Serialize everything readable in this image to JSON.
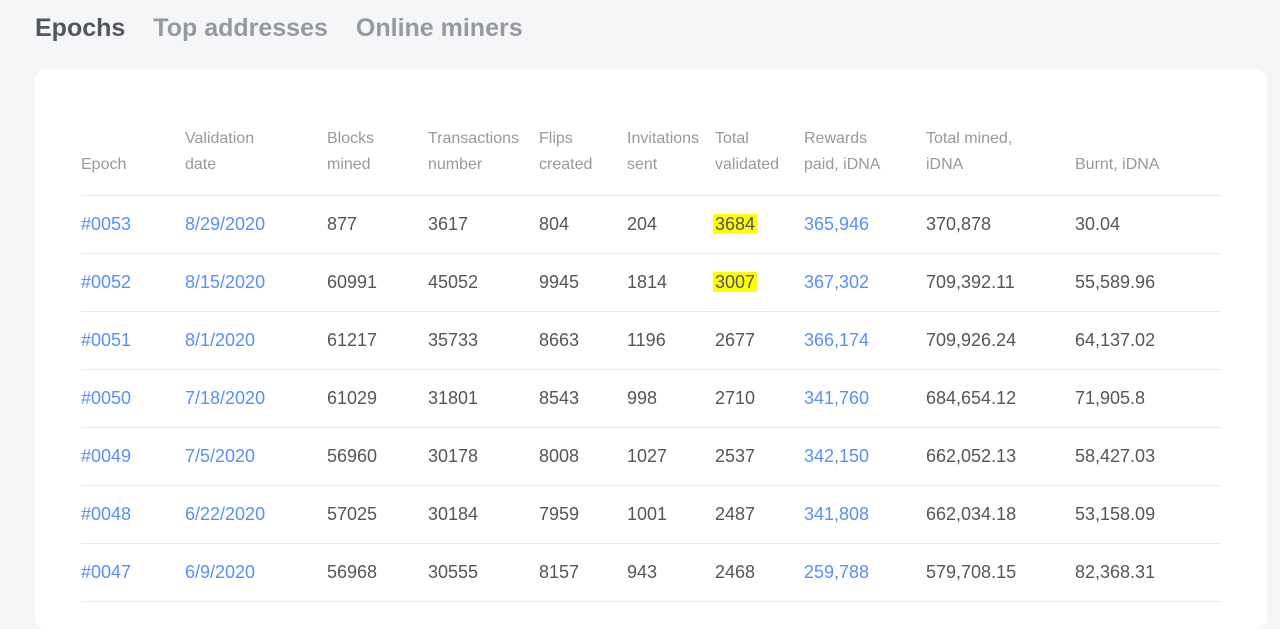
{
  "tabs": [
    {
      "label": "Epochs",
      "active": true
    },
    {
      "label": "Top addresses",
      "active": false
    },
    {
      "label": "Online miners",
      "active": false
    }
  ],
  "table": {
    "headers": {
      "epoch": "Epoch",
      "validation_date_1": "Validation",
      "validation_date_2": "date",
      "blocks_1": "Blocks",
      "blocks_2": "mined",
      "tx_1": "Transactions",
      "tx_2": "number",
      "flips_1": "Flips",
      "flips_2": "created",
      "inv_1": "Invitations",
      "inv_2": "sent",
      "validated_1": "Total",
      "validated_2": "validated",
      "rewards_1": "Rewards",
      "rewards_2": "paid, iDNA",
      "mined_1": "Total mined,",
      "mined_2": "iDNA",
      "burnt": "Burnt, iDNA"
    },
    "rows": [
      {
        "epoch": "#0053",
        "date": "8/29/2020",
        "blocks": "877",
        "tx": "3617",
        "flips": "804",
        "invites": "204",
        "validated": "3684",
        "rewards": "365,946",
        "mined": "370,878",
        "burnt": "30.04"
      },
      {
        "epoch": "#0052",
        "date": "8/15/2020",
        "blocks": "60991",
        "tx": "45052",
        "flips": "9945",
        "invites": "1814",
        "validated": "3007",
        "rewards": "367,302",
        "mined": "709,392.11",
        "burnt": "55,589.96"
      },
      {
        "epoch": "#0051",
        "date": "8/1/2020",
        "blocks": "61217",
        "tx": "35733",
        "flips": "8663",
        "invites": "1196",
        "validated": "2677",
        "rewards": "366,174",
        "mined": "709,926.24",
        "burnt": "64,137.02"
      },
      {
        "epoch": "#0050",
        "date": "7/18/2020",
        "blocks": "61029",
        "tx": "31801",
        "flips": "8543",
        "invites": "998",
        "validated": "2710",
        "rewards": "341,760",
        "mined": "684,654.12",
        "burnt": "71,905.8"
      },
      {
        "epoch": "#0049",
        "date": "7/5/2020",
        "blocks": "56960",
        "tx": "30178",
        "flips": "8008",
        "invites": "1027",
        "validated": "2537",
        "rewards": "342,150",
        "mined": "662,052.13",
        "burnt": "58,427.03"
      },
      {
        "epoch": "#0048",
        "date": "6/22/2020",
        "blocks": "57025",
        "tx": "30184",
        "flips": "7959",
        "invites": "1001",
        "validated": "2487",
        "rewards": "341,808",
        "mined": "662,034.18",
        "burnt": "53,158.09"
      },
      {
        "epoch": "#0047",
        "date": "6/9/2020",
        "blocks": "56968",
        "tx": "30555",
        "flips": "8157",
        "invites": "943",
        "validated": "2468",
        "rewards": "259,788",
        "mined": "579,708.15",
        "burnt": "82,368.31"
      }
    ]
  },
  "colors": {
    "link": "#578fff",
    "highlight": "#ffff00"
  }
}
